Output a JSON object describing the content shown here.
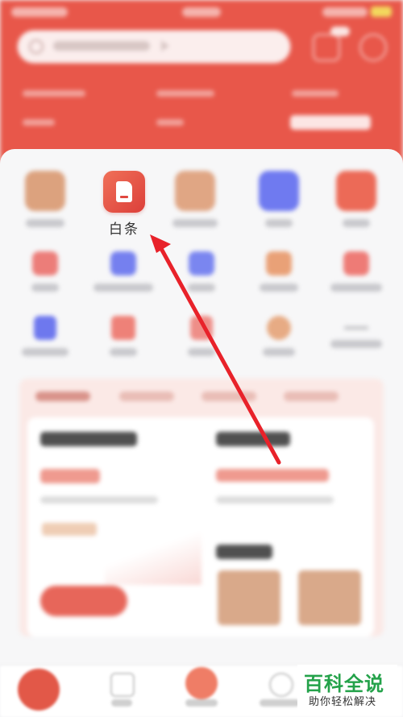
{
  "featured": {
    "label": "白条",
    "color": "#e8483f"
  },
  "colors": {
    "header": "#e8574a",
    "arrow": "#e8222a",
    "watermark_green": "#24a24a"
  },
  "watermark": {
    "title": "百科全说",
    "subtitle": "助你轻松解决"
  }
}
